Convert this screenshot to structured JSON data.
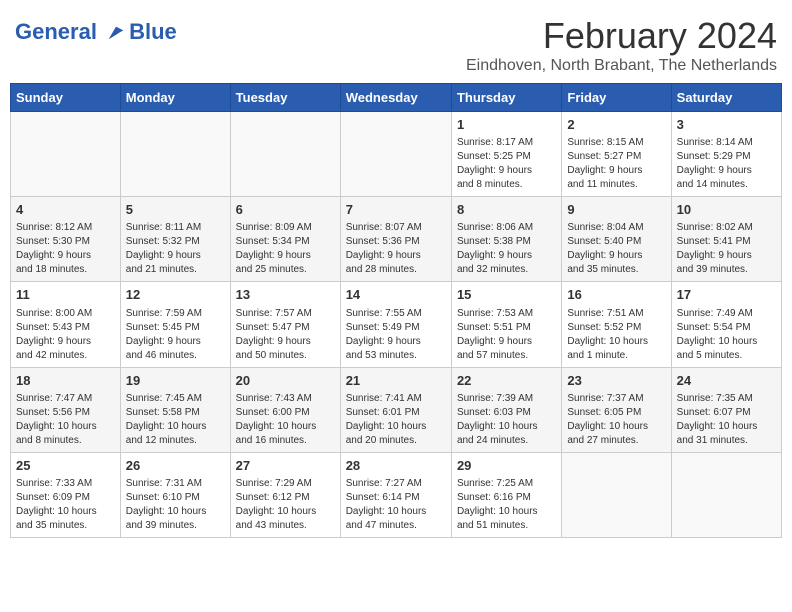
{
  "header": {
    "logo_line1": "General",
    "logo_line2": "Blue",
    "month": "February 2024",
    "location": "Eindhoven, North Brabant, The Netherlands"
  },
  "days_of_week": [
    "Sunday",
    "Monday",
    "Tuesday",
    "Wednesday",
    "Thursday",
    "Friday",
    "Saturday"
  ],
  "weeks": [
    [
      {
        "day": "",
        "info": ""
      },
      {
        "day": "",
        "info": ""
      },
      {
        "day": "",
        "info": ""
      },
      {
        "day": "",
        "info": ""
      },
      {
        "day": "1",
        "info": "Sunrise: 8:17 AM\nSunset: 5:25 PM\nDaylight: 9 hours\nand 8 minutes."
      },
      {
        "day": "2",
        "info": "Sunrise: 8:15 AM\nSunset: 5:27 PM\nDaylight: 9 hours\nand 11 minutes."
      },
      {
        "day": "3",
        "info": "Sunrise: 8:14 AM\nSunset: 5:29 PM\nDaylight: 9 hours\nand 14 minutes."
      }
    ],
    [
      {
        "day": "4",
        "info": "Sunrise: 8:12 AM\nSunset: 5:30 PM\nDaylight: 9 hours\nand 18 minutes."
      },
      {
        "day": "5",
        "info": "Sunrise: 8:11 AM\nSunset: 5:32 PM\nDaylight: 9 hours\nand 21 minutes."
      },
      {
        "day": "6",
        "info": "Sunrise: 8:09 AM\nSunset: 5:34 PM\nDaylight: 9 hours\nand 25 minutes."
      },
      {
        "day": "7",
        "info": "Sunrise: 8:07 AM\nSunset: 5:36 PM\nDaylight: 9 hours\nand 28 minutes."
      },
      {
        "day": "8",
        "info": "Sunrise: 8:06 AM\nSunset: 5:38 PM\nDaylight: 9 hours\nand 32 minutes."
      },
      {
        "day": "9",
        "info": "Sunrise: 8:04 AM\nSunset: 5:40 PM\nDaylight: 9 hours\nand 35 minutes."
      },
      {
        "day": "10",
        "info": "Sunrise: 8:02 AM\nSunset: 5:41 PM\nDaylight: 9 hours\nand 39 minutes."
      }
    ],
    [
      {
        "day": "11",
        "info": "Sunrise: 8:00 AM\nSunset: 5:43 PM\nDaylight: 9 hours\nand 42 minutes."
      },
      {
        "day": "12",
        "info": "Sunrise: 7:59 AM\nSunset: 5:45 PM\nDaylight: 9 hours\nand 46 minutes."
      },
      {
        "day": "13",
        "info": "Sunrise: 7:57 AM\nSunset: 5:47 PM\nDaylight: 9 hours\nand 50 minutes."
      },
      {
        "day": "14",
        "info": "Sunrise: 7:55 AM\nSunset: 5:49 PM\nDaylight: 9 hours\nand 53 minutes."
      },
      {
        "day": "15",
        "info": "Sunrise: 7:53 AM\nSunset: 5:51 PM\nDaylight: 9 hours\nand 57 minutes."
      },
      {
        "day": "16",
        "info": "Sunrise: 7:51 AM\nSunset: 5:52 PM\nDaylight: 10 hours\nand 1 minute."
      },
      {
        "day": "17",
        "info": "Sunrise: 7:49 AM\nSunset: 5:54 PM\nDaylight: 10 hours\nand 5 minutes."
      }
    ],
    [
      {
        "day": "18",
        "info": "Sunrise: 7:47 AM\nSunset: 5:56 PM\nDaylight: 10 hours\nand 8 minutes."
      },
      {
        "day": "19",
        "info": "Sunrise: 7:45 AM\nSunset: 5:58 PM\nDaylight: 10 hours\nand 12 minutes."
      },
      {
        "day": "20",
        "info": "Sunrise: 7:43 AM\nSunset: 6:00 PM\nDaylight: 10 hours\nand 16 minutes."
      },
      {
        "day": "21",
        "info": "Sunrise: 7:41 AM\nSunset: 6:01 PM\nDaylight: 10 hours\nand 20 minutes."
      },
      {
        "day": "22",
        "info": "Sunrise: 7:39 AM\nSunset: 6:03 PM\nDaylight: 10 hours\nand 24 minutes."
      },
      {
        "day": "23",
        "info": "Sunrise: 7:37 AM\nSunset: 6:05 PM\nDaylight: 10 hours\nand 27 minutes."
      },
      {
        "day": "24",
        "info": "Sunrise: 7:35 AM\nSunset: 6:07 PM\nDaylight: 10 hours\nand 31 minutes."
      }
    ],
    [
      {
        "day": "25",
        "info": "Sunrise: 7:33 AM\nSunset: 6:09 PM\nDaylight: 10 hours\nand 35 minutes."
      },
      {
        "day": "26",
        "info": "Sunrise: 7:31 AM\nSunset: 6:10 PM\nDaylight: 10 hours\nand 39 minutes."
      },
      {
        "day": "27",
        "info": "Sunrise: 7:29 AM\nSunset: 6:12 PM\nDaylight: 10 hours\nand 43 minutes."
      },
      {
        "day": "28",
        "info": "Sunrise: 7:27 AM\nSunset: 6:14 PM\nDaylight: 10 hours\nand 47 minutes."
      },
      {
        "day": "29",
        "info": "Sunrise: 7:25 AM\nSunset: 6:16 PM\nDaylight: 10 hours\nand 51 minutes."
      },
      {
        "day": "",
        "info": ""
      },
      {
        "day": "",
        "info": ""
      }
    ]
  ]
}
